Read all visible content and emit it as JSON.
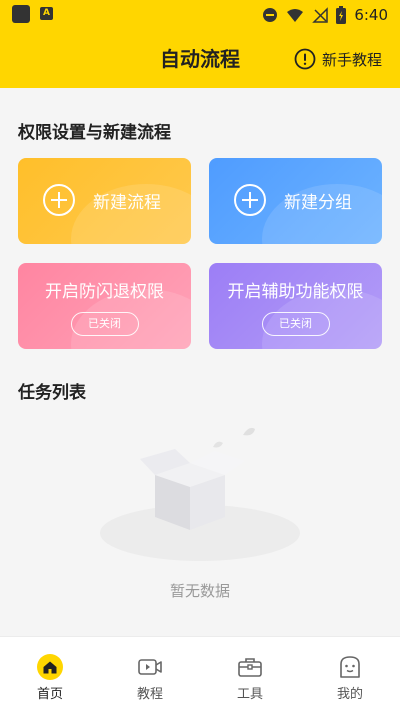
{
  "status_bar": {
    "time": "6:40"
  },
  "header": {
    "title": "自动流程",
    "tutorial_label": "新手教程"
  },
  "permissions_section": {
    "title": "权限设置与新建流程",
    "new_flow_label": "新建流程",
    "new_group_label": "新建分组",
    "anti_exit": {
      "label": "开启防闪退权限",
      "status": "已关闭"
    },
    "accessibility": {
      "label": "开启辅助功能权限",
      "status": "已关闭"
    }
  },
  "task_section": {
    "title": "任务列表",
    "empty_text": "暂无数据"
  },
  "tabbar": {
    "items": [
      {
        "label": "首页",
        "icon": "home-icon",
        "active": true
      },
      {
        "label": "教程",
        "icon": "video-icon",
        "active": false
      },
      {
        "label": "工具",
        "icon": "toolbox-icon",
        "active": false
      },
      {
        "label": "我的",
        "icon": "face-icon",
        "active": false
      }
    ]
  },
  "colors": {
    "brand_yellow": "#ffd600",
    "card_orange": "#ffbf2a",
    "card_blue": "#4f9cff",
    "card_pink": "#ff85a1",
    "card_purple": "#9c7ef6"
  }
}
